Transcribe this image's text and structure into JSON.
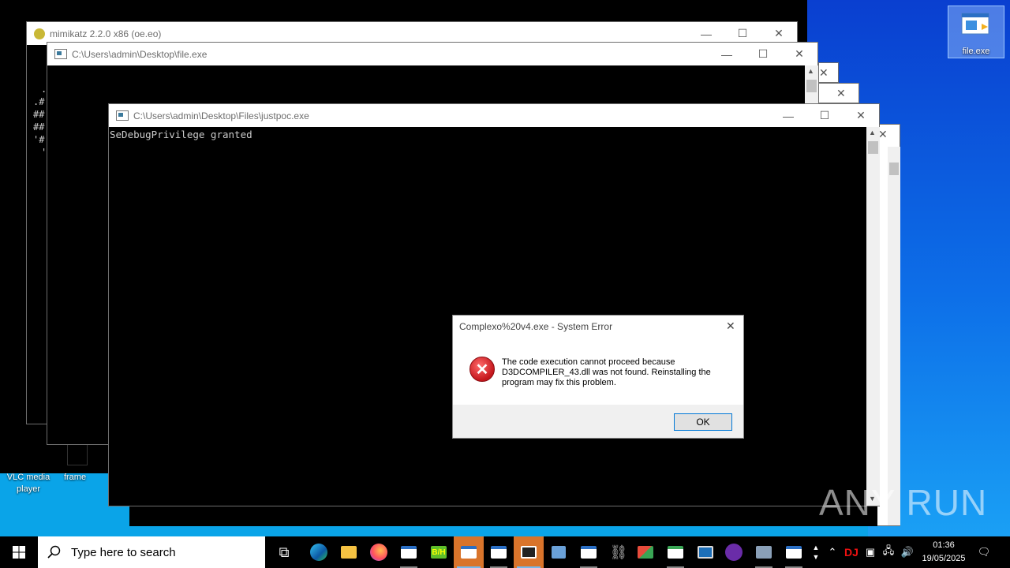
{
  "desktop": {
    "icons": [
      {
        "label": "VLC media player"
      },
      {
        "label": "frame"
      },
      {
        "label": "file.exe"
      }
    ],
    "watermark": "ANY RUN"
  },
  "windows": {
    "mimikatz": {
      "title": "mimikatz 2.2.0 x86 (oe.eo)",
      "console_lines": [
        ".#",
        ".#",
        "##",
        "##",
        "'#",
        "'"
      ]
    },
    "file_exe": {
      "title": "C:\\Users\\admin\\Desktop\\file.exe"
    },
    "justpoc": {
      "title": "C:\\Users\\admin\\Desktop\\Files\\justpoc.exe",
      "console_output": "SeDebugPrivilege granted"
    }
  },
  "error_dialog": {
    "title": "Complexo%20v4.exe - System Error",
    "message": "The code execution cannot proceed because D3DCOMPILER_43.dll was not found. Reinstalling the program may fix this problem.",
    "ok_label": "OK"
  },
  "taskbar": {
    "search_placeholder": "Type here to search",
    "time": "01:36",
    "date": "19/05/2025",
    "apps": [
      "task-view",
      "edge",
      "file-explorer",
      "firefox",
      "window",
      "bh",
      "window",
      "window",
      "mimikatz",
      "network",
      "window",
      "link",
      "office",
      "window",
      "remote",
      "purple-app",
      "installer",
      "window"
    ],
    "tray_text": "DJ"
  },
  "colors": {
    "accent": "#0078d7",
    "desktop_blue": "#0d6fe8",
    "error_red": "#c4161c"
  }
}
